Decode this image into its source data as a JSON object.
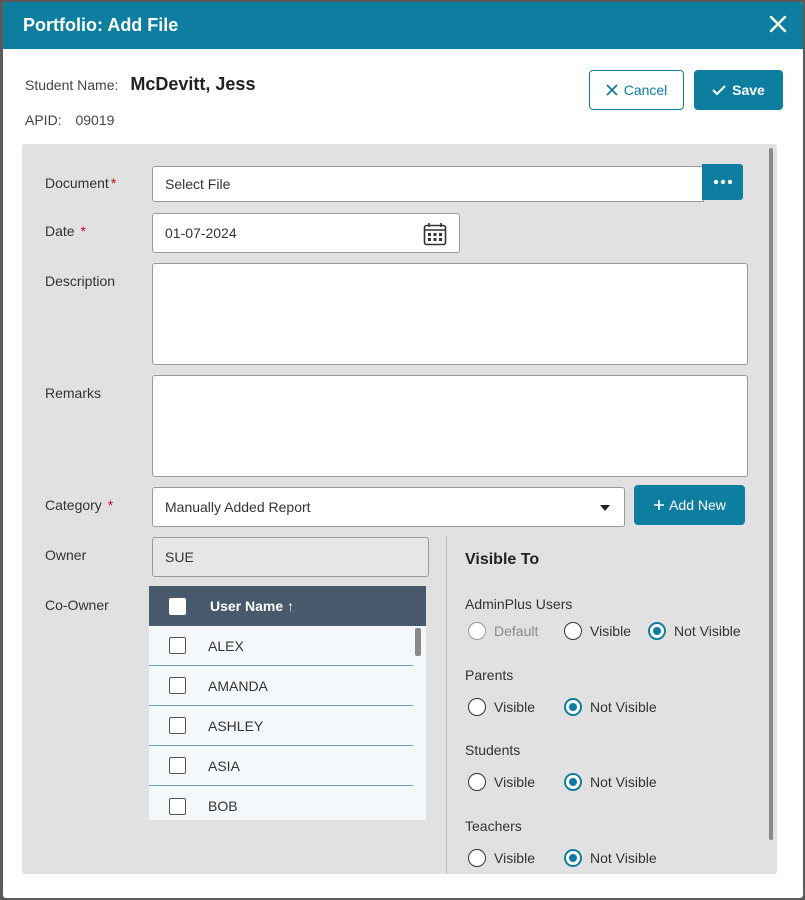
{
  "modal": {
    "title": "Portfolio: Add File",
    "student_name_label": "Student Name:",
    "student_name": "McDevitt, Jess",
    "apid_label": "APID:",
    "apid": "09019",
    "cancel_label": "Cancel",
    "save_label": "Save",
    "accent_color": "#0d7ea0"
  },
  "form": {
    "document_label": "Document",
    "document_value": "Select File",
    "date_label": "Date",
    "date_value": "01-07-2024",
    "description_label": "Description",
    "remarks_label": "Remarks",
    "category_label": "Category",
    "category_value": "Manually Added Report",
    "add_new_label": "Add New",
    "owner_label": "Owner",
    "owner_value": "SUE",
    "coowner_label": "Co-Owner",
    "required_mark": "*"
  },
  "coowner_grid": {
    "header": "User Name",
    "sort_arrow": "↑",
    "rows": [
      "ALEX",
      "AMANDA",
      "ASHLEY",
      "ASIA",
      "BOB"
    ]
  },
  "visible_to": {
    "title": "Visible To",
    "groups": [
      {
        "label": "AdminPlus Users",
        "options": [
          "Default",
          "Visible",
          "Not Visible"
        ],
        "selected": "Not Visible"
      },
      {
        "label": "Parents",
        "options": [
          "Visible",
          "Not Visible"
        ],
        "selected": "Not Visible"
      },
      {
        "label": "Students",
        "options": [
          "Visible",
          "Not Visible"
        ],
        "selected": "Not Visible"
      },
      {
        "label": "Teachers",
        "options": [
          "Visible",
          "Not Visible"
        ],
        "selected": "Not Visible"
      }
    ]
  }
}
